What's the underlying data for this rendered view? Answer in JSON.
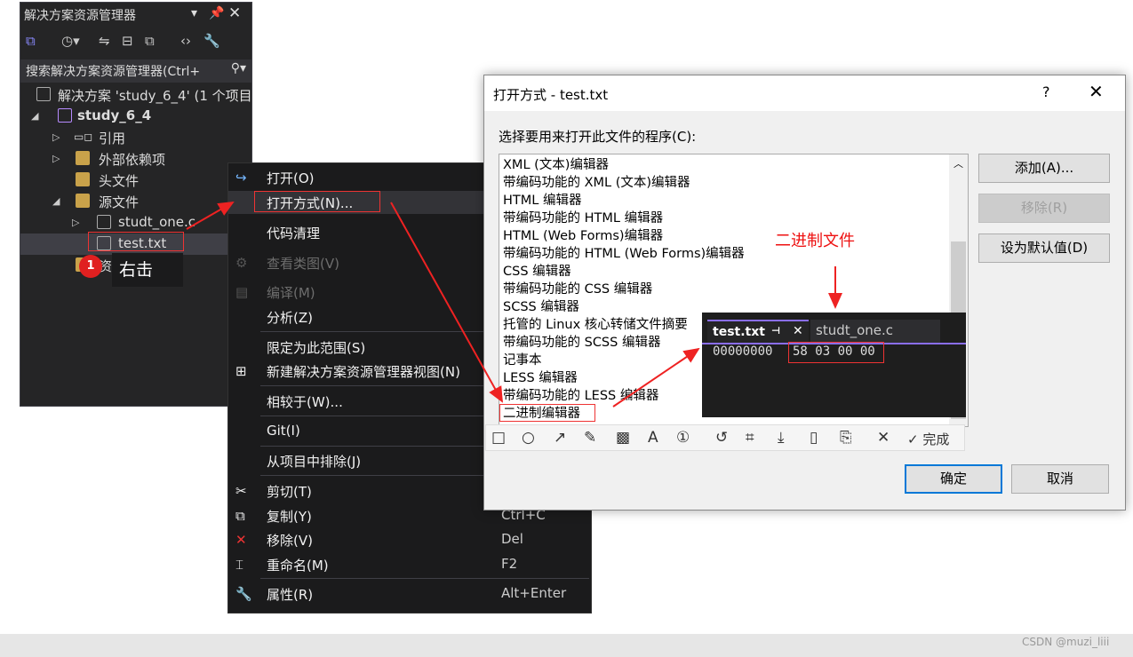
{
  "solution_explorer": {
    "title": "解决方案资源管理器",
    "search_placeholder": "搜索解决方案资源管理器(Ctrl+",
    "tree": {
      "solution": "解决方案 'study_6_4' (1 个项目",
      "project": "study_6_4",
      "references": "引用",
      "external_deps": "外部依赖项",
      "headers": "头文件",
      "sources": "源文件",
      "file_c": "studt_one.c",
      "file_txt": "test.txt",
      "resources": "资源文件"
    }
  },
  "annotation": {
    "step": "1",
    "right_click": "右击",
    "binary_file": "二进制文件"
  },
  "context_menu": {
    "open": "打开(O)",
    "open_with": "打开方式(N)...",
    "code_cleanup": "代码清理",
    "view_class_diagram": "查看类图(V)",
    "compile": "编译(M)",
    "analyze": "分析(Z)",
    "scope": "限定为此范围(S)",
    "new_view": "新建解决方案资源管理器视图(N)",
    "compare": "相较于(W)...",
    "git": "Git(I)",
    "exclude": "从项目中排除(J)",
    "cut": "剪切(T)",
    "copy": "复制(Y)",
    "copy_sc": "Ctrl+C",
    "remove": "移除(V)",
    "remove_sc": "Del",
    "rename": "重命名(M)",
    "rename_sc": "F2",
    "properties": "属性(R)",
    "properties_sc": "Alt+Enter"
  },
  "dialog": {
    "title": "打开方式 - test.txt",
    "help": "?",
    "label": "选择要用来打开此文件的程序(C):",
    "items": [
      "XML (文本)编辑器",
      "带编码功能的 XML (文本)编辑器",
      "HTML 编辑器",
      "带编码功能的 HTML 编辑器",
      "HTML (Web Forms)编辑器",
      "带编码功能的 HTML (Web Forms)编辑器",
      "CSS 编辑器",
      "带编码功能的 CSS 编辑器",
      "SCSS 编辑器",
      "托管的 Linux 核心转储文件摘要",
      "带编码功能的 SCSS 编辑器",
      "记事本",
      "LESS 编辑器",
      "带编码功能的 LESS 编辑器",
      "二进制编辑器"
    ],
    "add": "添加(A)...",
    "remove": "移除(R)",
    "set_default": "设为默认值(D)",
    "ok": "确定",
    "cancel": "取消"
  },
  "hex_editor": {
    "tab_active": "test.txt",
    "tab_other": "studt_one.c",
    "address": "00000000",
    "bytes": "58 03 00 00"
  },
  "snip_toolbar": {
    "done": "完成"
  },
  "watermark": "CSDN @muzi_liii"
}
